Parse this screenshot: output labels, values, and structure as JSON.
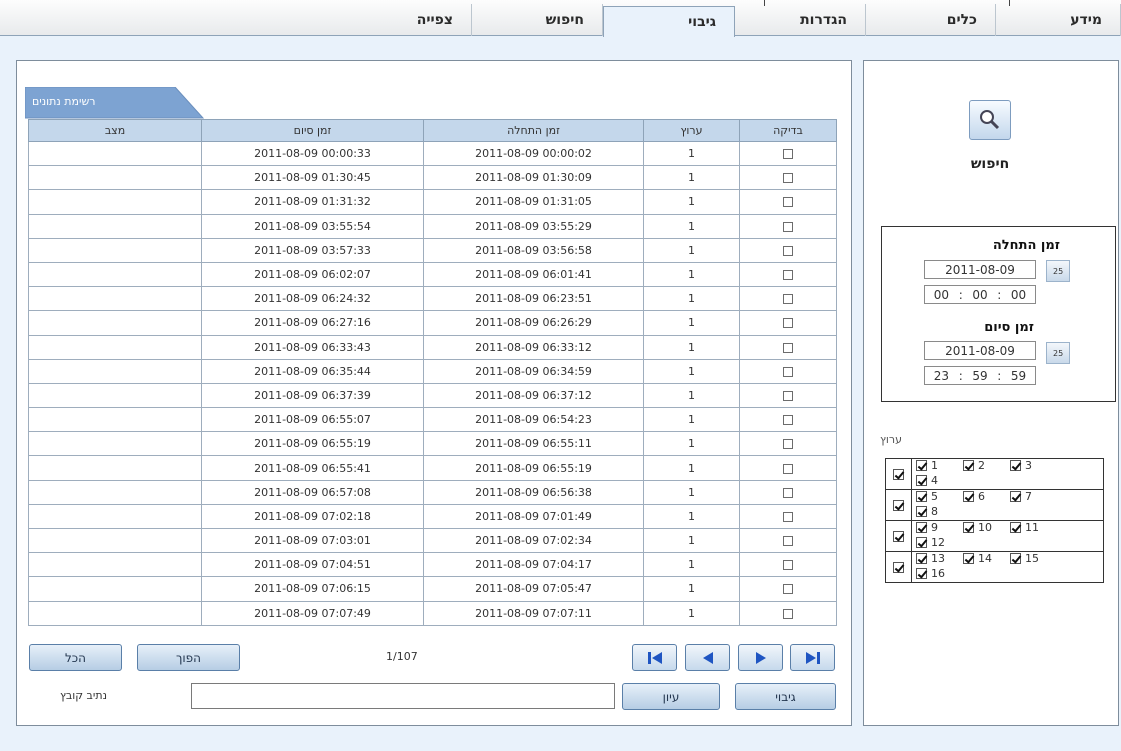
{
  "top_nav": {
    "tabs": [
      {
        "label": "מידע"
      },
      {
        "label": "כלים"
      },
      {
        "label": "הגדרות"
      },
      {
        "label": "גיבוי",
        "active": true
      },
      {
        "label": "חיפוש"
      },
      {
        "label": "צפייה"
      }
    ]
  },
  "data_list": {
    "tab_label": "רשימת נתונים",
    "columns": [
      "מצב",
      "זמן סיום",
      "זמן התחלה",
      "ערוץ",
      "בדיקה"
    ],
    "rows": [
      {
        "status": "",
        "end": "2011-08-09 00:00:33",
        "start": "2011-08-09 00:00:02",
        "channel": "1"
      },
      {
        "status": "",
        "end": "2011-08-09 01:30:45",
        "start": "2011-08-09 01:30:09",
        "channel": "1"
      },
      {
        "status": "",
        "end": "2011-08-09 01:31:32",
        "start": "2011-08-09 01:31:05",
        "channel": "1"
      },
      {
        "status": "",
        "end": "2011-08-09 03:55:54",
        "start": "2011-08-09 03:55:29",
        "channel": "1"
      },
      {
        "status": "",
        "end": "2011-08-09 03:57:33",
        "start": "2011-08-09 03:56:58",
        "channel": "1"
      },
      {
        "status": "",
        "end": "2011-08-09 06:02:07",
        "start": "2011-08-09 06:01:41",
        "channel": "1"
      },
      {
        "status": "",
        "end": "2011-08-09 06:24:32",
        "start": "2011-08-09 06:23:51",
        "channel": "1"
      },
      {
        "status": "",
        "end": "2011-08-09 06:27:16",
        "start": "2011-08-09 06:26:29",
        "channel": "1"
      },
      {
        "status": "",
        "end": "2011-08-09 06:33:43",
        "start": "2011-08-09 06:33:12",
        "channel": "1"
      },
      {
        "status": "",
        "end": "2011-08-09 06:35:44",
        "start": "2011-08-09 06:34:59",
        "channel": "1"
      },
      {
        "status": "",
        "end": "2011-08-09 06:37:39",
        "start": "2011-08-09 06:37:12",
        "channel": "1"
      },
      {
        "status": "",
        "end": "2011-08-09 06:55:07",
        "start": "2011-08-09 06:54:23",
        "channel": "1"
      },
      {
        "status": "",
        "end": "2011-08-09 06:55:19",
        "start": "2011-08-09 06:55:11",
        "channel": "1"
      },
      {
        "status": "",
        "end": "2011-08-09 06:55:41",
        "start": "2011-08-09 06:55:19",
        "channel": "1"
      },
      {
        "status": "",
        "end": "2011-08-09 06:57:08",
        "start": "2011-08-09 06:56:38",
        "channel": "1"
      },
      {
        "status": "",
        "end": "2011-08-09 07:02:18",
        "start": "2011-08-09 07:01:49",
        "channel": "1"
      },
      {
        "status": "",
        "end": "2011-08-09 07:03:01",
        "start": "2011-08-09 07:02:34",
        "channel": "1"
      },
      {
        "status": "",
        "end": "2011-08-09 07:04:51",
        "start": "2011-08-09 07:04:17",
        "channel": "1"
      },
      {
        "status": "",
        "end": "2011-08-09 07:06:15",
        "start": "2011-08-09 07:05:47",
        "channel": "1"
      },
      {
        "status": "",
        "end": "2011-08-09 07:07:49",
        "start": "2011-08-09 07:07:11",
        "channel": "1"
      }
    ],
    "select_all_label": "הכל",
    "invert_label": "הפוך",
    "page_indicator": "1/107",
    "nav_icons": [
      "last-page-icon",
      "next-page-icon",
      "prev-page-icon",
      "first-page-icon"
    ],
    "backup_label": "גיבוי",
    "browse_label": "עיון",
    "path_value": "",
    "path_label": "נתיב קובץ"
  },
  "search_panel": {
    "search_icon": "magnifier-icon",
    "search_label": "חיפוש",
    "start_time_label": "זמן התחלה",
    "start_date": "2011-08-09",
    "start_clock": [
      "00",
      "00",
      "00"
    ],
    "end_time_label": "זמן סיום",
    "end_date": "2011-08-09",
    "end_clock": [
      "23",
      "59",
      "59"
    ],
    "calendar_day": "25",
    "channel_label": "ערוץ",
    "channel_rows": [
      [
        "1",
        "2",
        "3",
        "4"
      ],
      [
        "5",
        "6",
        "7",
        "8"
      ],
      [
        "9",
        "10",
        "11",
        "12"
      ],
      [
        "13",
        "14",
        "15",
        "16"
      ]
    ]
  },
  "colors": {
    "page_bg": "#e9f2fb",
    "header_cell": "#c4d7eb",
    "tab_blue": "#7da3d2",
    "button_border": "#5a7fa8",
    "nav_arrow": "#1f55c2"
  }
}
